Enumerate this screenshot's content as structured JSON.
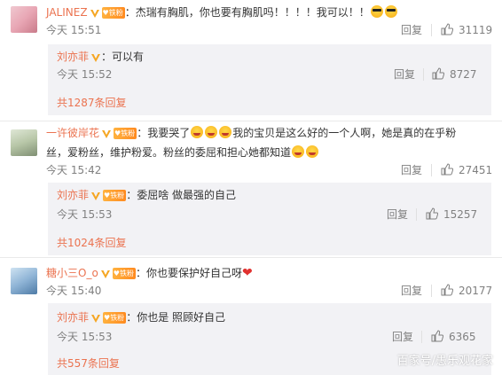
{
  "comments": [
    {
      "username": "JALINEZ",
      "text": "：杰瑞有胸肌，你也要有胸肌吗！！！！我可以！！",
      "time": "今天 15:51",
      "reply_label": "回复",
      "likes": "31119",
      "reply": {
        "username": "刘亦菲",
        "text": "：可以有",
        "time": "今天 15:52",
        "reply_label": "回复",
        "likes": "8727"
      },
      "more_replies": "共1287条回复"
    },
    {
      "username": "一许彼岸花",
      "text_part1": "：我要哭了",
      "text_part2": "我的宝贝是这么好的一个人啊，她是真的在乎粉",
      "text_line2": "丝，爱粉丝，维护粉爱。粉丝的委屈和担心她都知道",
      "time": "今天 15:42",
      "reply_label": "回复",
      "likes": "27451",
      "reply": {
        "username": "刘亦菲",
        "text": "：委屈啥 做最强的自己",
        "time": "今天 15:53",
        "reply_label": "回复",
        "likes": "15257"
      },
      "more_replies": "共1024条回复"
    },
    {
      "username": "糖小三O_o",
      "text": "：你也要保护好自己呀",
      "time": "今天 15:40",
      "reply_label": "回复",
      "likes": "20177",
      "reply": {
        "username": "刘亦菲",
        "text": "：你也是 照顾好自己",
        "time": "今天 15:53",
        "reply_label": "回复",
        "likes": "6365"
      },
      "more_replies": "共557条回复"
    }
  ],
  "fan_badge_label": "铁粉",
  "watermark": "百家号/愚乐观花家",
  "colors": {
    "username": "#eb7350",
    "reply_bg": "#f2f2f5",
    "meta": "#808080"
  },
  "icons": [
    "thumbs-up-icon",
    "verified-v-icon",
    "fan-badge-icon",
    "cool-emoji",
    "cry-emoji",
    "red-heart-emoji"
  ]
}
